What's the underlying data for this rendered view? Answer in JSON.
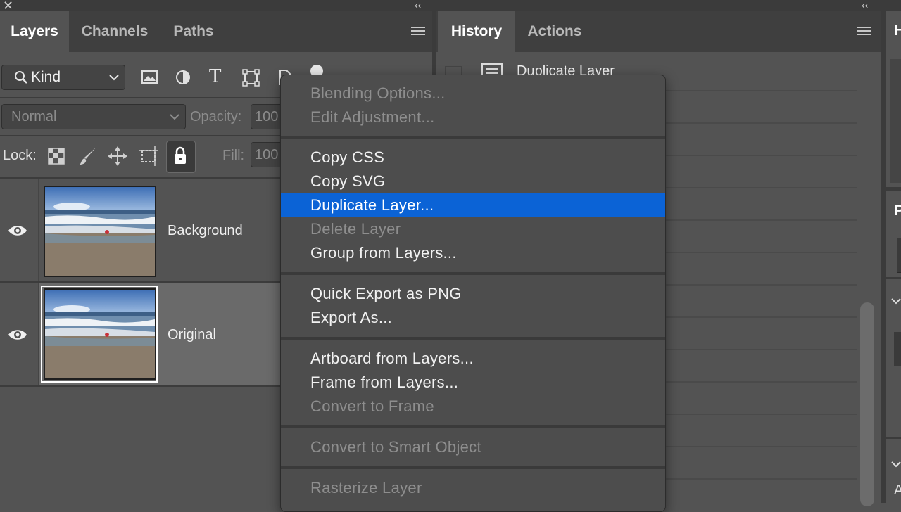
{
  "layers_panel": {
    "tabs": [
      "Layers",
      "Channels",
      "Paths"
    ],
    "filter": {
      "label": "Kind"
    },
    "blend_mode": "Normal",
    "opacity_label": "Opacity:",
    "opacity_value": "100",
    "lock_label": "Lock:",
    "fill_label": "Fill:",
    "fill_value": "100",
    "layers": [
      {
        "name": "Background",
        "visible": true,
        "selected": false
      },
      {
        "name": "Original",
        "visible": true,
        "selected": true
      }
    ]
  },
  "history_panel": {
    "tabs": [
      "History",
      "Actions"
    ],
    "items": [
      "Duplicate Layer"
    ]
  },
  "right_partial": {
    "labels": [
      "H",
      "P",
      "A"
    ]
  },
  "context_menu": {
    "groups": [
      [
        {
          "label": "Blending Options...",
          "enabled": false
        },
        {
          "label": "Edit Adjustment...",
          "enabled": false
        }
      ],
      [
        {
          "label": "Copy CSS",
          "enabled": true
        },
        {
          "label": "Copy SVG",
          "enabled": true
        },
        {
          "label": "Duplicate Layer...",
          "enabled": true,
          "highlighted": true
        },
        {
          "label": "Delete Layer",
          "enabled": false
        },
        {
          "label": "Group from Layers...",
          "enabled": true
        }
      ],
      [
        {
          "label": "Quick Export as PNG",
          "enabled": true
        },
        {
          "label": "Export As...",
          "enabled": true
        }
      ],
      [
        {
          "label": "Artboard from Layers...",
          "enabled": true
        },
        {
          "label": "Frame from Layers...",
          "enabled": true
        },
        {
          "label": "Convert to Frame",
          "enabled": false
        }
      ],
      [
        {
          "label": "Convert to Smart Object",
          "enabled": false
        }
      ],
      [
        {
          "label": "Rasterize Layer",
          "enabled": false
        }
      ]
    ]
  },
  "colors": {
    "highlight": "#0b63d6",
    "panel_bg": "#535353",
    "tabbar_bg": "#3f3f3f"
  }
}
